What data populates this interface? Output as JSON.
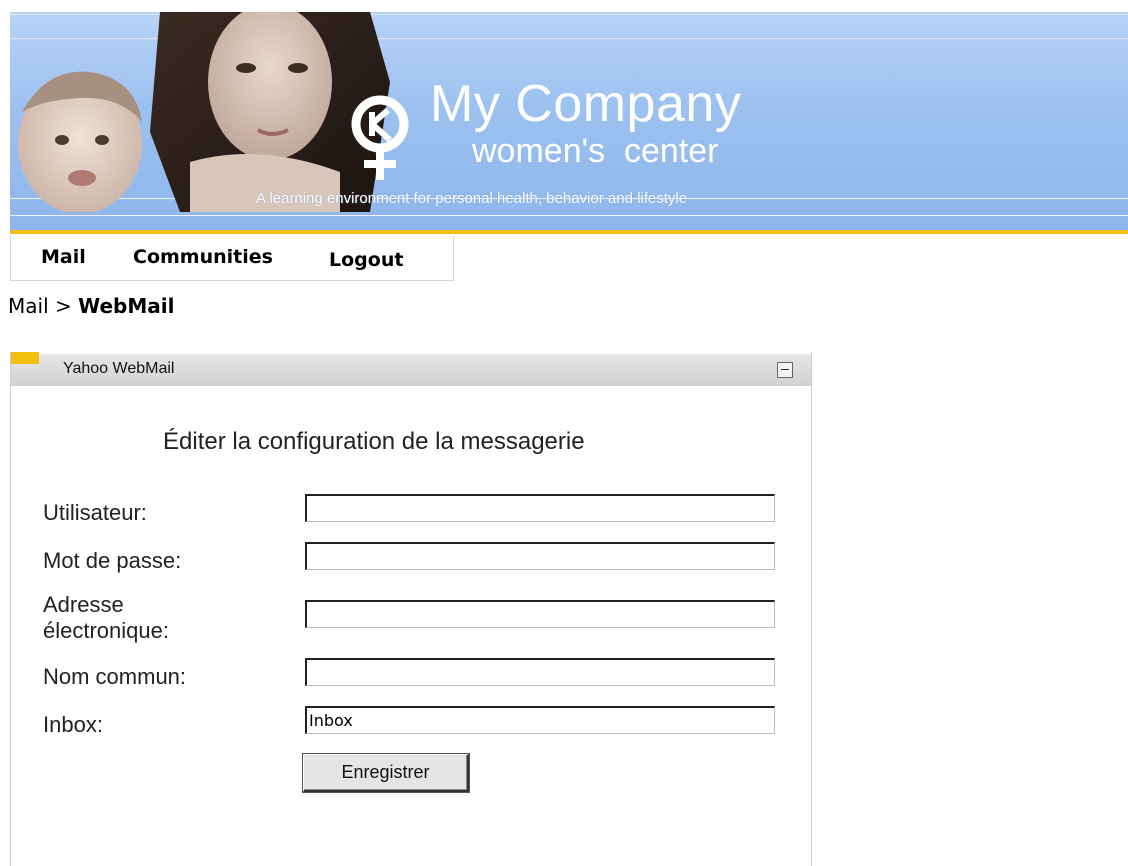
{
  "banner": {
    "brand_name": "My Company",
    "brand_sub": "women's  center",
    "tagline": "A learning environment for personal health, behavior and lifestyle"
  },
  "nav": {
    "items": [
      {
        "label": "Mail"
      },
      {
        "label": "Communities"
      },
      {
        "label": "Logout"
      }
    ]
  },
  "breadcrumb": {
    "parent": "Mail",
    "separator": ">",
    "current": "WebMail"
  },
  "portlet": {
    "title": "Yahoo WebMail",
    "form_title": "Éditer la configuration de la messagerie",
    "fields": [
      {
        "label": "Utilisateur:",
        "value": ""
      },
      {
        "label": "Mot de passe:",
        "value": ""
      },
      {
        "label": "Adresse\nélectronique:",
        "value": ""
      },
      {
        "label": "Nom commun:",
        "value": ""
      },
      {
        "label": "Inbox:",
        "value": "Inbox"
      }
    ],
    "save_label": "Enregistrer"
  },
  "colors": {
    "banner_blue": "#9cc1f0",
    "accent_gold": "#f2bf10",
    "header_gray": "#d9d9d9"
  }
}
